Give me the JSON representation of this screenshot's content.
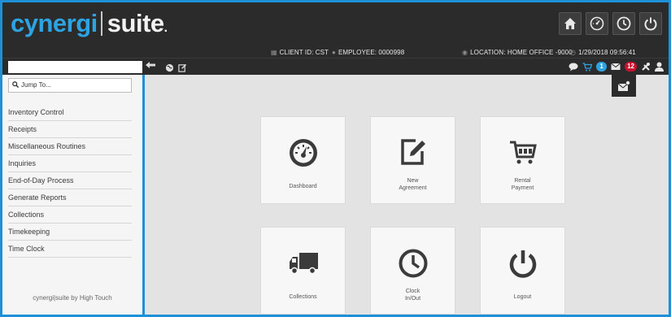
{
  "app": {
    "logo_part1": "cynergi",
    "logo_part2": "suite",
    "logo_dot": "."
  },
  "header": {
    "client_id": "CLIENT ID: CST",
    "employee": "EMPLOYEE: 0000998",
    "location": "LOCATION: HOME OFFICE -9000",
    "datetime": "1/29/2018 09:56:41",
    "buttons": [
      "home-icon",
      "dashboard-icon",
      "clock-icon",
      "power-icon"
    ]
  },
  "toolbar": {
    "back_icon": "arrow-left-icon",
    "cart_badge": "1",
    "mail_badge": "12"
  },
  "sidebar": {
    "search_placeholder": "Jump To...",
    "items": [
      "Inventory Control",
      "Receipts",
      "Miscellaneous Routines",
      "Inquiries",
      "End-of-Day Process",
      "Generate Reports",
      "Collections",
      "Timekeeping",
      "Time Clock"
    ],
    "footer": "cynergi|suite by High Touch"
  },
  "tiles": [
    {
      "id": "dashboard",
      "label1": "Dashboard",
      "label2": "",
      "icon": "dashboard-icon"
    },
    {
      "id": "new-agreement",
      "label1": "New",
      "label2": "Agreement",
      "icon": "edit-icon"
    },
    {
      "id": "rental-payment",
      "label1": "Rental",
      "label2": "Payment",
      "icon": "cart-icon"
    },
    {
      "id": "collections",
      "label1": "Collections",
      "label2": "",
      "icon": "truck-icon"
    },
    {
      "id": "clock-in-out",
      "label1": "Clock",
      "label2": "In/Out",
      "icon": "clock-icon"
    },
    {
      "id": "logout",
      "label1": "Logout",
      "label2": "",
      "icon": "power-icon"
    }
  ],
  "colors": {
    "accent": "#1e90d8",
    "header_bg": "#2b2b2b",
    "logo_blue": "#2ea3e2",
    "badge_red": "#c8102e"
  }
}
